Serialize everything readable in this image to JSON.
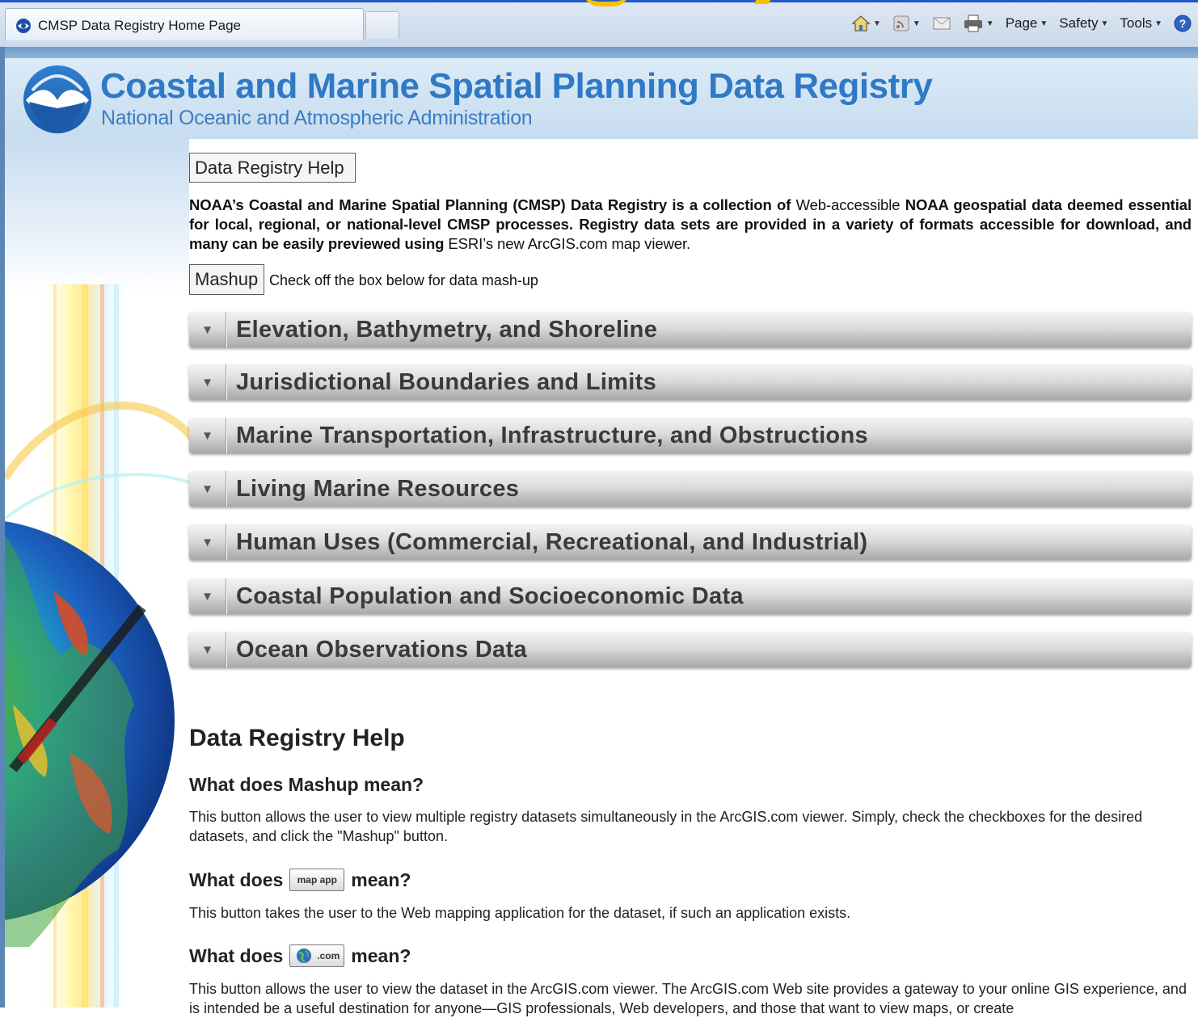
{
  "browser": {
    "tab_title": "CMSP Data Registry Home Page",
    "commands": [
      {
        "label": "",
        "icon": "home-icon"
      },
      {
        "label": "",
        "icon": "feeds-icon"
      },
      {
        "label": "",
        "icon": "mail-icon"
      },
      {
        "label": "",
        "icon": "print-icon"
      },
      {
        "label": "Page",
        "icon": ""
      },
      {
        "label": "Safety",
        "icon": ""
      },
      {
        "label": "Tools",
        "icon": ""
      },
      {
        "label": "",
        "icon": "help-icon"
      }
    ]
  },
  "header": {
    "title": "Coastal and Marine Spatial Planning Data Registry",
    "subtitle": "National Oceanic and Atmospheric Administration"
  },
  "main": {
    "help_button": "Data Registry Help",
    "intro_bold_1": "NOAA’s Coastal and Marine Spatial Planning (CMSP) Data Registry is a collection of ",
    "intro_normal_1": "Web-accessible",
    "intro_bold_2": " NOAA geospatial data deemed essential for local, regional, or national-level CMSP processes. Registry data sets are provided in a variety of formats accessible for download, and many can be easily previewed using ",
    "intro_normal_2": "ESRI’s new ArcGIS.com map viewer.",
    "mashup_button": "Mashup",
    "mashup_note": "Check off the box below for data mash-up",
    "categories": [
      "Elevation, Bathymetry, and Shoreline",
      "Jurisdictional Boundaries and Limits",
      "Marine Transportation, Infrastructure, and Obstructions",
      "Living Marine Resources",
      "Human Uses (Commercial, Recreational, and Industrial)",
      "Coastal Population and Socioeconomic Data",
      "Ocean Observations Data"
    ]
  },
  "help": {
    "heading": "Data Registry Help",
    "q1": "What does Mashup mean?",
    "a1": "This button allows the user to view multiple registry datasets simultaneously in the ArcGIS.com viewer. Simply, check the checkboxes for the desired datasets, and click the \"Mashup\" button.",
    "q2_prefix": "What does",
    "q2_button": "map app",
    "q2_suffix": "mean?",
    "a2": "This button takes the user to the Web mapping application for the dataset, if such an application exists.",
    "q3_prefix": "What does",
    "q3_button": ".com",
    "q3_suffix": "mean?",
    "a3": "This button allows the user to view the dataset in the ArcGIS.com viewer.  The ArcGIS.com Web site provides a gateway to your online GIS experience, and is intended be a useful destination for anyone—GIS professionals, Web developers, and those that want to view maps, or create"
  }
}
